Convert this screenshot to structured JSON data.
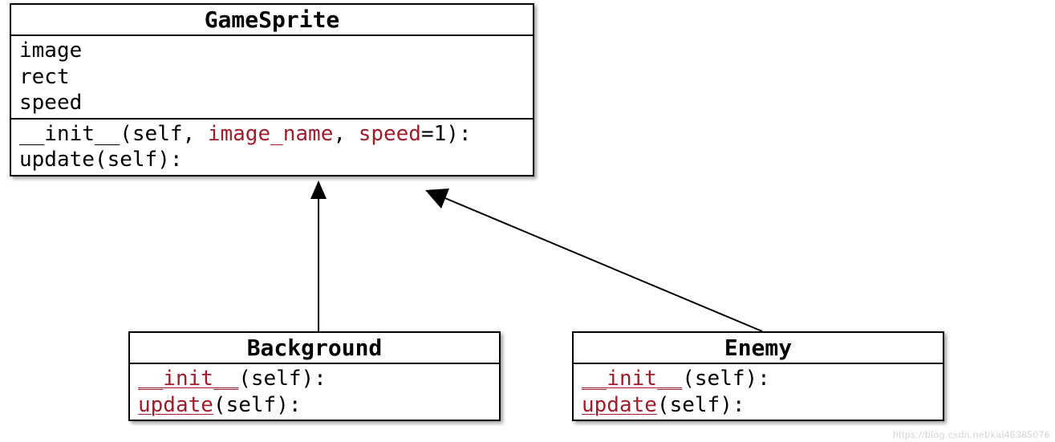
{
  "classes": {
    "gamesprite": {
      "name": "GameSprite",
      "attrs": [
        "image",
        "rect",
        "speed"
      ],
      "init_method": "__init__",
      "init_self": "self",
      "init_param1": "image_name",
      "init_param2": "speed",
      "init_default": "1",
      "update_method": "update",
      "update_self": "self"
    },
    "background": {
      "name": "Background",
      "init_method": "__init__",
      "init_self": "self",
      "update_method": "update",
      "update_self": "self"
    },
    "enemy": {
      "name": "Enemy",
      "init_method": "__init__",
      "init_self": "self",
      "update_method": "update",
      "update_self": "self"
    }
  },
  "colors": {
    "keyword": "#a11c2a",
    "text": "#000000",
    "border": "#000000"
  },
  "watermark": "https://blog.csdn.net/kai46385076"
}
